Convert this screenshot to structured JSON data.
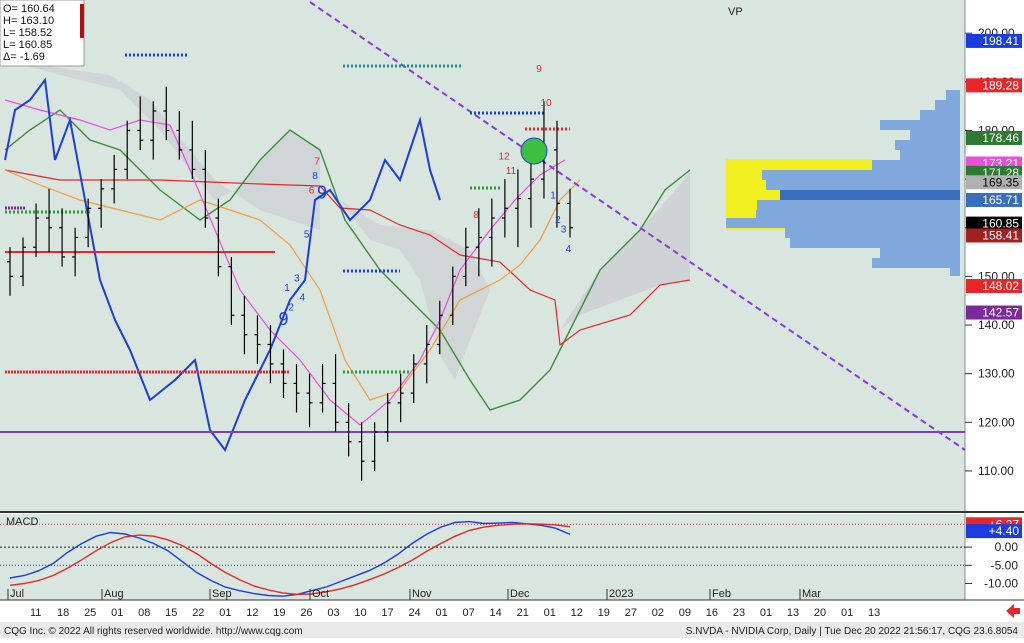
{
  "ohlc_box": {
    "lines": [
      "O= 160.64",
      "H= 163.10",
      "L= 158.52",
      "L= 160.85",
      "Δ=  -1.69"
    ]
  },
  "vp_label": "VP",
  "macd_label": "MACD",
  "footer": {
    "left": "CQG Inc. © 2022 All rights reserved worldwide. http://www.cqg.com",
    "right": "S.NVDA - NVIDIA Corp, Daily | Tue Dec 20 2022 21:56:17, CQG 23.6.8054"
  },
  "colors": {
    "background": "#d9e6df",
    "price_axis": "#ffffff",
    "accent_red": "#e8262a",
    "accent_blue": "#1b3de0",
    "accent_purple": "#8a3bd0",
    "ichimoku_cloud": "#c9c9cf"
  },
  "chart_data": {
    "type": "bar",
    "title": "",
    "xlabel": "",
    "ylabel": "",
    "ylim": [
      103,
      206
    ],
    "price_ticks": [
      110,
      120,
      130,
      140,
      150,
      160,
      170,
      180,
      190,
      200
    ],
    "price_tags": [
      {
        "value": "198.41",
        "bg": "#1b3de0",
        "fg": "#ffffff"
      },
      {
        "value": "189.28",
        "bg": "#e8262a",
        "fg": "#ffffff"
      },
      {
        "value": "178.46",
        "bg": "#2d7a32",
        "fg": "#ffffff"
      },
      {
        "value": "173.21",
        "bg": "#e94fd8",
        "fg": "#ffffff"
      },
      {
        "value": "171.28",
        "bg": "#2d7a32",
        "fg": "#ffffff"
      },
      {
        "value": "169.35",
        "bg": "#b0b0b0",
        "fg": "#000000"
      },
      {
        "value": "165.71",
        "bg": "#3a6ebd",
        "fg": "#ffffff"
      },
      {
        "value": "160.85",
        "bg": "#000000",
        "fg": "#ffffff"
      },
      {
        "value": "158.41",
        "bg": "#a32020",
        "fg": "#ffffff"
      },
      {
        "value": "148.02",
        "bg": "#e8262a",
        "fg": "#ffffff"
      },
      {
        "value": "142.57",
        "bg": "#7b2a9a",
        "fg": "#ffffff"
      }
    ],
    "x_month_labels": [
      "Jul",
      "Aug",
      "Sep",
      "Oct",
      "Nov",
      "Dec",
      "2023",
      "Feb",
      "Mar"
    ],
    "x_day_labels": [
      "11",
      "18",
      "25",
      "01",
      "08",
      "15",
      "22",
      "01",
      "12",
      "19",
      "26",
      "03",
      "10",
      "17",
      "24",
      "01",
      "07",
      "14",
      "21",
      "01",
      "12",
      "19",
      "27",
      "02",
      "09",
      "16",
      "23",
      "01",
      "13",
      "20",
      "01",
      "13"
    ],
    "macd": {
      "ylim": [
        -14,
        8
      ],
      "ticks": [
        -10.0,
        -5.0,
        0.0
      ],
      "tick_labels": [
        "-10.00",
        "-5.00",
        "0.00"
      ],
      "tags": [
        {
          "value": "+6.27",
          "bg": "#e8262a",
          "fg": "#ffffff"
        },
        {
          "value": "+4.40",
          "bg": "#1b3de0",
          "fg": "#ffffff"
        }
      ],
      "macd_line": [
        -8.5,
        -7.8,
        -6.5,
        -4.5,
        -1.5,
        1.0,
        3.0,
        4.0,
        3.6,
        2.5,
        1.0,
        -1.0,
        -4.0,
        -7.0,
        -9.2,
        -11.0,
        -12.0,
        -12.8,
        -13.3,
        -13.5,
        -13.0,
        -12.0,
        -11.0,
        -9.5,
        -8.0,
        -6.5,
        -4.5,
        -2.0,
        1.0,
        3.5,
        5.5,
        6.8,
        7.0,
        6.5,
        6.6,
        6.8,
        6.4,
        6.0,
        5.2,
        3.5
      ],
      "signal_line": [
        -10.5,
        -10.0,
        -9.2,
        -7.8,
        -5.8,
        -3.5,
        -1.0,
        1.2,
        2.8,
        3.3,
        3.0,
        2.0,
        0.4,
        -1.8,
        -4.5,
        -7.0,
        -9.0,
        -10.7,
        -11.8,
        -12.6,
        -13.0,
        -12.9,
        -12.3,
        -11.5,
        -10.4,
        -9.0,
        -7.5,
        -5.7,
        -3.6,
        -1.2,
        1.0,
        3.0,
        4.6,
        5.5,
        6.0,
        6.3,
        6.4,
        6.3,
        6.1,
        5.6
      ]
    },
    "ohlc": [
      [
        153,
        156,
        146,
        150
      ],
      [
        150,
        158,
        148,
        156
      ],
      [
        156,
        165,
        154,
        162
      ],
      [
        162,
        168,
        155,
        160
      ],
      [
        160,
        164,
        152,
        154
      ],
      [
        154,
        160,
        150,
        158
      ],
      [
        158,
        166,
        156,
        164
      ],
      [
        164,
        170,
        160,
        168
      ],
      [
        168,
        175,
        165,
        172
      ],
      [
        172,
        182,
        170,
        180
      ],
      [
        180,
        187,
        176,
        178
      ],
      [
        178,
        186,
        174,
        184
      ],
      [
        184,
        189,
        178,
        180
      ],
      [
        180,
        184,
        174,
        176
      ],
      [
        176,
        182,
        170,
        172
      ],
      [
        172,
        176,
        160,
        162
      ],
      [
        162,
        166,
        150,
        152
      ],
      [
        152,
        154,
        140,
        142
      ],
      [
        142,
        146,
        134,
        138
      ],
      [
        138,
        142,
        132,
        136
      ],
      [
        136,
        140,
        128,
        132
      ],
      [
        132,
        135,
        125,
        128
      ],
      [
        128,
        132,
        122,
        126
      ],
      [
        126,
        130,
        119,
        124
      ],
      [
        124,
        132,
        122,
        128
      ],
      [
        128,
        134,
        118,
        120
      ],
      [
        120,
        124,
        113,
        116
      ],
      [
        116,
        120,
        108,
        112
      ],
      [
        112,
        120,
        110,
        118
      ],
      [
        118,
        126,
        116,
        124
      ],
      [
        124,
        130,
        120,
        126
      ],
      [
        126,
        134,
        124,
        132
      ],
      [
        132,
        140,
        128,
        136
      ],
      [
        136,
        145,
        134,
        142
      ],
      [
        142,
        152,
        140,
        150
      ],
      [
        150,
        160,
        148,
        156
      ],
      [
        156,
        164,
        150,
        158
      ],
      [
        158,
        166,
        152,
        162
      ],
      [
        162,
        170,
        158,
        164
      ],
      [
        164,
        172,
        156,
        166
      ],
      [
        166,
        176,
        160,
        170
      ],
      [
        170,
        186,
        166,
        176
      ],
      [
        176,
        182,
        160,
        165
      ],
      [
        165,
        168,
        158,
        160
      ]
    ],
    "sequential_counts": [
      {
        "label": "9",
        "color": "#e8262a",
        "big": false,
        "x": 0.77,
        "y": 192
      },
      {
        "label": "10",
        "color": "#e8262a",
        "big": false,
        "x": 0.78,
        "y": 185
      },
      {
        "label": "9",
        "color": "#1b3de0",
        "big": true,
        "x": 0.405,
        "y": 140
      },
      {
        "label": "9",
        "color": "#1b3de0",
        "big": true,
        "x": 0.46,
        "y": 166
      },
      {
        "label": "8",
        "color": "#1b3de0",
        "big": false,
        "x": 0.45,
        "y": 170
      },
      {
        "label": "7",
        "color": "#e8262a",
        "big": false,
        "x": 0.453,
        "y": 173
      },
      {
        "label": "6",
        "color": "#e8262a",
        "big": false,
        "x": 0.445,
        "y": 167
      },
      {
        "label": "5",
        "color": "#1b3de0",
        "big": false,
        "x": 0.438,
        "y": 158
      },
      {
        "label": "4",
        "color": "#1b3de0",
        "big": false,
        "x": 0.432,
        "y": 145
      },
      {
        "label": "3",
        "color": "#1b3de0",
        "big": false,
        "x": 0.424,
        "y": 149
      },
      {
        "label": "2",
        "color": "#1b3de0",
        "big": false,
        "x": 0.416,
        "y": 143
      },
      {
        "label": "1",
        "color": "#1b3de0",
        "big": false,
        "x": 0.41,
        "y": 147
      },
      {
        "label": "11",
        "color": "#e8262a",
        "big": false,
        "x": 0.73,
        "y": 171
      },
      {
        "label": "12",
        "color": "#e8262a",
        "big": false,
        "x": 0.72,
        "y": 174
      },
      {
        "label": "8",
        "color": "#e8262a",
        "big": false,
        "x": 0.68,
        "y": 162
      },
      {
        "label": "1",
        "color": "#1b3de0",
        "big": false,
        "x": 0.79,
        "y": 166
      },
      {
        "label": "2",
        "color": "#1b3de0",
        "big": false,
        "x": 0.797,
        "y": 161
      },
      {
        "label": "3",
        "color": "#1b3de0",
        "big": false,
        "x": 0.805,
        "y": 159
      },
      {
        "label": "4",
        "color": "#1b3de0",
        "big": false,
        "x": 0.812,
        "y": 155
      }
    ]
  }
}
